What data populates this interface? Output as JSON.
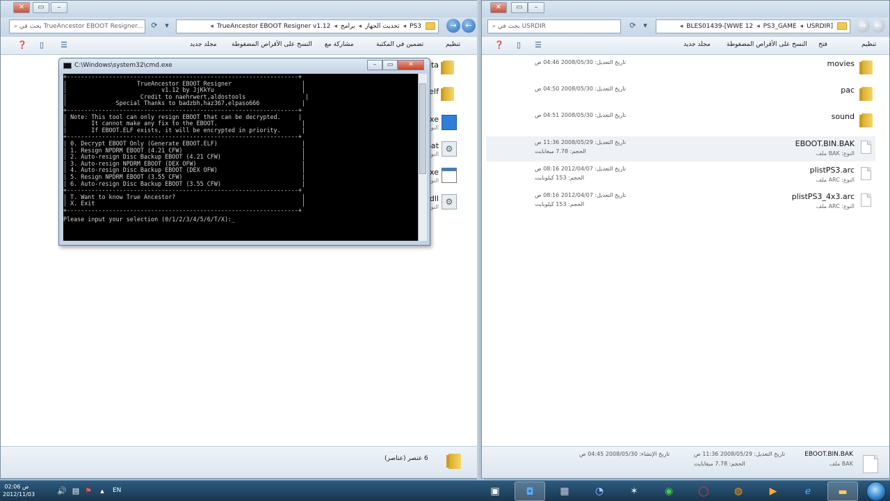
{
  "left_window": {
    "address_path": [
      "PS3",
      "تحديث الجهاز",
      "برامج",
      "TrueAncestor EBOOT Resigner v1.12"
    ],
    "search_placeholder": "بحث في TrueAncestor EBOOT Resigner...",
    "toolbar": [
      "تنظيم",
      "تضمين في المكتبة",
      "مشاركة مع",
      "النسخ على الأقراص المضغوطة",
      "مجلد جديد"
    ],
    "partial_items": [
      {
        "name": "ata",
        "type": "",
        "icon": "folder-icon"
      },
      {
        "name": "self",
        "type": "",
        "icon": "folder-icon"
      },
      {
        "name": "exe",
        "type": "النوع",
        "icon": "app-icon"
      },
      {
        "name": "bat",
        "type": "النوع",
        "icon": "gear-file-icon"
      },
      {
        "name": "exe",
        "type": "النوع",
        "icon": "window-icon"
      },
      {
        "name": "dll",
        "type": "النوع",
        "icon": "gear-file-icon"
      }
    ],
    "status_text": "6 عنصر (عناصر)"
  },
  "right_window": {
    "address_path": [
      "[BLES01439-[WWE 12",
      "PS3_GAME",
      "USRDIR"
    ],
    "search_placeholder": "بحث في USRDIR",
    "toolbar": [
      "تنظيم",
      "فتح",
      "النسخ على الأقراص المضغوطة",
      "مجلد جديد"
    ],
    "files": [
      {
        "name": "movies",
        "type": "",
        "date": "تاريخ التعديل: 2008/05/30 04:46 ص",
        "size": "",
        "icon": "folder-icon"
      },
      {
        "name": "pac",
        "type": "",
        "date": "تاريخ التعديل: 2008/05/30 04:50 ص",
        "size": "",
        "icon": "folder-icon"
      },
      {
        "name": "sound",
        "type": "",
        "date": "تاريخ التعديل: 2008/05/30 04:51 ص",
        "size": "",
        "icon": "folder-icon"
      },
      {
        "name": "EBOOT.BIN.BAK",
        "type": "النوع: BAK ملف",
        "date": "تاريخ التعديل: 2008/05/29 11:36 ص",
        "size": "الحجم: 7.78 ميغابايت",
        "icon": "file-icon"
      },
      {
        "name": "plistPS3.arc",
        "type": "النوع: ARC ملف",
        "date": "تاريخ التعديل: 2012/04/07 08:16 ص",
        "size": "الحجم: 153 كيلوبايت",
        "icon": "file-icon"
      },
      {
        "name": "plistPS3_4x3.arc",
        "type": "النوع: ARC ملف",
        "date": "تاريخ التعديل: 2012/04/07 08:16 ص",
        "size": "الحجم: 153 كيلوبايت",
        "icon": "file-icon"
      }
    ],
    "details": {
      "name": "EBOOT.BIN.BAK",
      "type": "BAK ملف",
      "modified": "تاريخ التعديل: 2008/05/29 11:36 ص",
      "size": "الحجم: 7.78 ميغابايت",
      "created": "تاريخ الإنشاء: 2008/05/30 04:45 ص"
    }
  },
  "cmd": {
    "title": "C:\\Windows\\system32\\cmd.exe",
    "lines": [
      "+------------------------------------------------------------------+",
      "|                    TrueAncestor EBOOT Resigner                    |",
      "|                           v1.12 by JjKkYu                         |",
      "|                     Credit to naehrwert,aldostools                 |",
      "|              Special Thanks to badzbh,haz367,elpaso666            |",
      "+------------------------------------------------------------------+",
      "| Note: This tool can only resign EBOOT that can be decrypted.     |",
      "|       It cannot make any fix to the EBOOT.                        |",
      "|       If EBOOT.ELF exists, it will be encrypted in priority.      |",
      "+------------------------------------------------------------------+",
      "| 0. Decrypt EBOOT Only (Generate EBOOT.ELF)                        |",
      "| 1. Resign NPDRM EBOOT (4.21 CFW)                                  |",
      "| 2. Auto-resign Disc Backup EBOOT (4.21 CFW)                       |",
      "| 3. Auto-resign NPDRM EBOOT (DEX OFW)                              |",
      "| 4. Auto-resign Disc Backup EBOOT (DEX OFW)                        |",
      "| 5. Resign NPDRM EBOOT (3.55 CFW)                                  |",
      "| 6. Auto-resign Disc Backup EBOOT (3.55 CFW)                       |",
      "+------------------------------------------------------------------+",
      "| T. Want to know True Ancestor?                                    |",
      "| X. Exit                                                           |",
      "+------------------------------------------------------------------+",
      "Please input your selection (0/1/2/3/4/5/6/T/X):_"
    ]
  },
  "taskbar": {
    "time": "02:06 ص",
    "date": "2012/11/03",
    "language": "EN",
    "apps": [
      "cmd-icon",
      "app-icon",
      "explorer-icon",
      "ps3-tool-icon",
      "star-tool-icon",
      "chrome-icon",
      "opera-icon",
      "firefox-icon",
      "media-player-icon",
      "ie-icon",
      "folder-icon",
      "start-orb-icon"
    ]
  }
}
